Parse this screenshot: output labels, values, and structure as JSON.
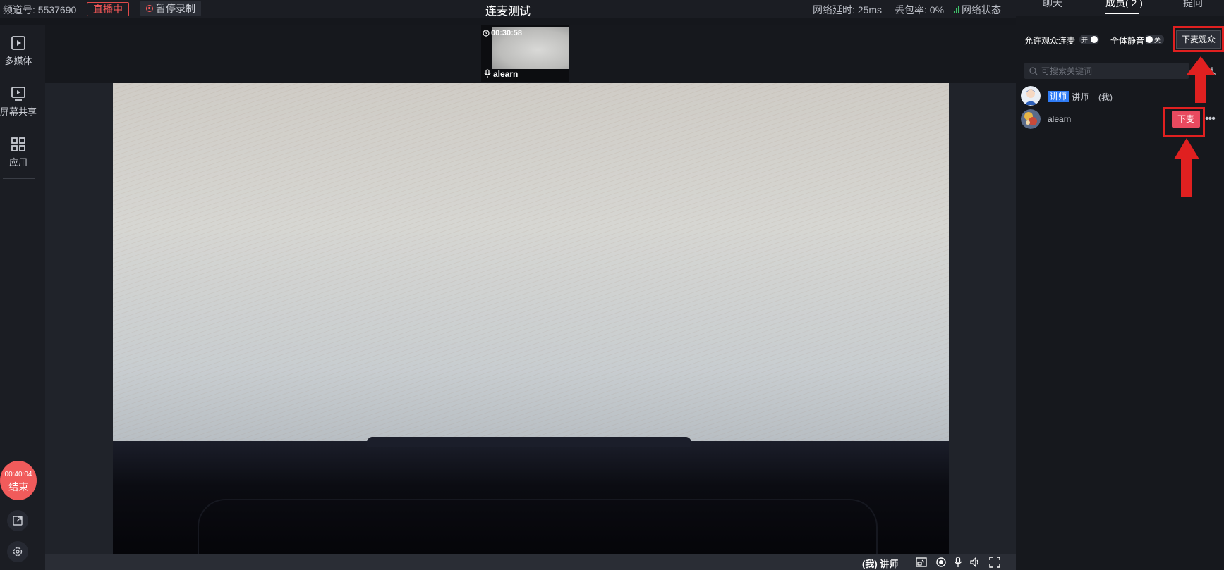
{
  "topbar": {
    "channel": "频道号: 5537690",
    "live_badge": "直播中",
    "pause_record": "暂停录制",
    "title": "连麦测试",
    "latency": "网络延时: 25ms",
    "packet_loss": "丢包率: 0%",
    "network_status": "网络状态"
  },
  "sidebar": {
    "items": [
      {
        "label": "多媒体",
        "icon": "play-icon"
      },
      {
        "label": "屏幕共享",
        "icon": "screen-share-icon"
      },
      {
        "label": "应用",
        "icon": "apps-grid-icon"
      }
    ],
    "end_time": "00:40:04",
    "end_label": "结束"
  },
  "video": {
    "thumb_time": "00:30:58",
    "thumb_name": "alearn"
  },
  "bottombar": {
    "me_label": "(我) 讲师"
  },
  "right_panel": {
    "tabs": [
      "聊天",
      "成员( 2 )",
      "提问"
    ],
    "allow_label": "允许观众连麦",
    "allow_state": "开",
    "mute_label": "全体静音",
    "mute_state": "关",
    "stage_down_audience": "下麦观众",
    "search_placeholder": "可搜索关键词",
    "person_label": "人",
    "members": [
      {
        "tag": "讲师",
        "name": "讲师",
        "suffix": "(我)"
      },
      {
        "name": "alearn",
        "action": "下麦"
      }
    ]
  },
  "colors": {
    "accent_red": "#e84a5f",
    "live_red": "#ff5a5a",
    "tag_blue": "#2f7cf6",
    "annotation_red": "#e02020"
  }
}
